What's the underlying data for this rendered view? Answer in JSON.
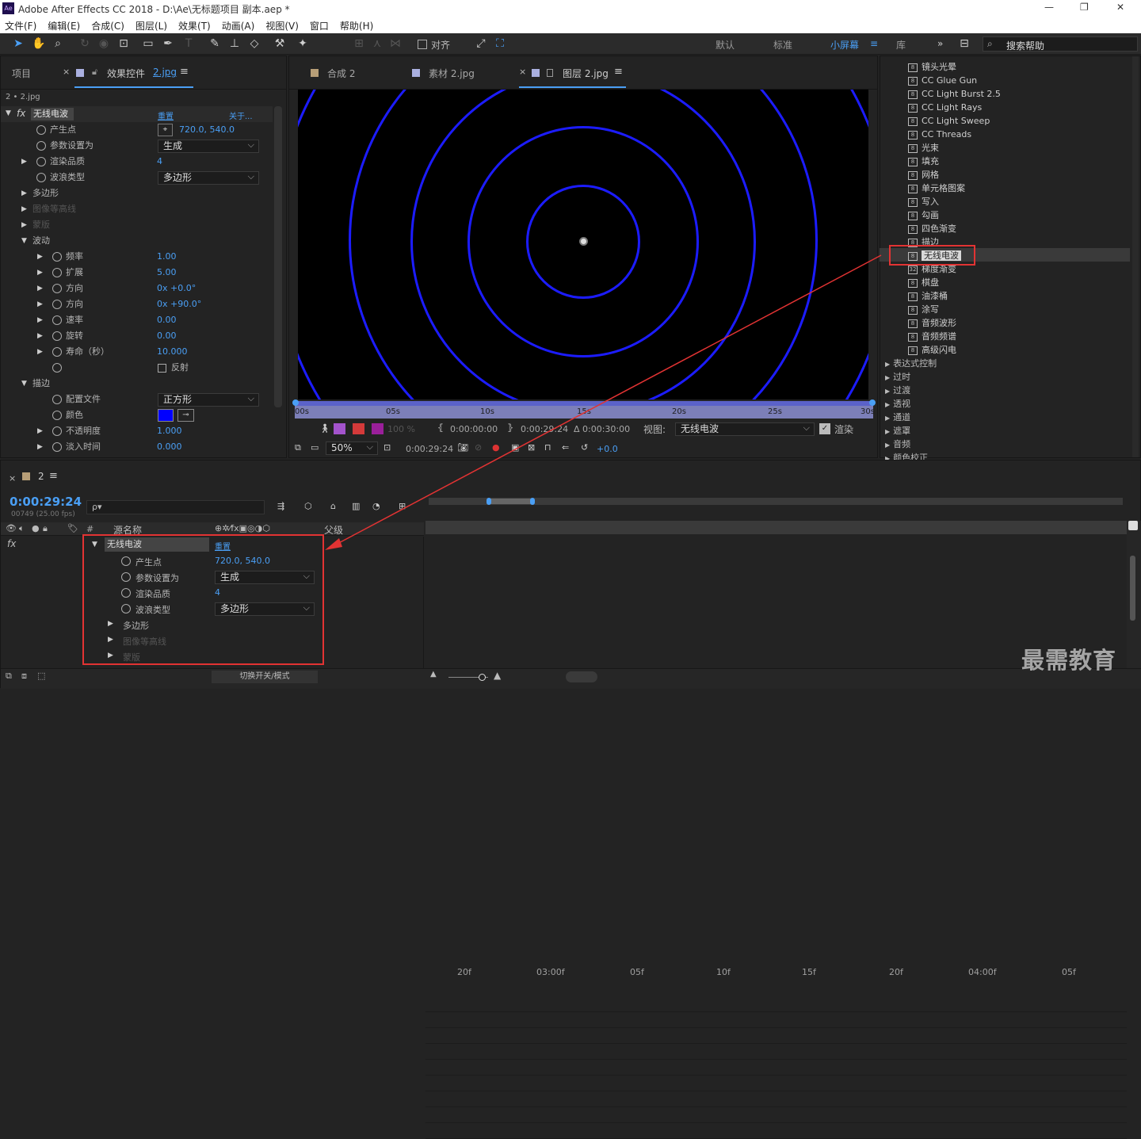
{
  "app": {
    "title": "Adobe After Effects CC 2018 - D:\\Ae\\无标题项目 副本.aep *",
    "icon": "Ae"
  },
  "window": {
    "minimize": "—",
    "restore": "❐",
    "close": "✕"
  },
  "menu": [
    "文件(F)",
    "编辑(E)",
    "合成(C)",
    "图层(L)",
    "效果(T)",
    "动画(A)",
    "视图(V)",
    "窗口",
    "帮助(H)"
  ],
  "toolbar": {
    "snap_label": "对齐",
    "workspaces": [
      "默认",
      "标准",
      "小屏幕",
      "库"
    ],
    "active_workspace": "小屏幕",
    "more": "»",
    "search_placeholder": "搜索帮助"
  },
  "effect_panel": {
    "project_tab": "项目",
    "tab_label": "效果控件",
    "tab_file": "2.jpg",
    "breadcrumb": "2 • 2.jpg",
    "effect_name": "无线电波",
    "reset": "重置",
    "about": "关于...",
    "rows": [
      {
        "label": "产生点",
        "value": "720.0, 540.0"
      },
      {
        "label": "参数设置为",
        "value": "生成"
      },
      {
        "label": "渲染品质",
        "value": "4"
      },
      {
        "label": "波浪类型",
        "value": "多边形"
      },
      {
        "label": "多边形"
      },
      {
        "label": "图像等高线"
      },
      {
        "label": "蒙版"
      },
      {
        "label": "波动"
      },
      {
        "label": "频率",
        "value": "1.00"
      },
      {
        "label": "扩展",
        "value": "5.00"
      },
      {
        "label": "方向",
        "value": "0x +0.0°"
      },
      {
        "label": "方向",
        "value": "0x +90.0°"
      },
      {
        "label": "速率",
        "value": "0.00"
      },
      {
        "label": "旋转",
        "value": "0.00"
      },
      {
        "label": "寿命（秒）",
        "value": "10.000"
      },
      {
        "label": "反射"
      },
      {
        "label": "描边"
      },
      {
        "label": "配置文件",
        "value": "正方形"
      },
      {
        "label": "颜色",
        "color": "#0000ff"
      },
      {
        "label": "不透明度",
        "value": "1.000"
      },
      {
        "label": "淡入时间",
        "value": "0.000"
      }
    ]
  },
  "viewer": {
    "tabs": [
      "合成 2",
      "素材 2.jpg",
      "图层 2.jpg"
    ],
    "ruler": [
      "00s",
      "05s",
      "10s",
      "15s",
      "20s",
      "25s",
      "30s"
    ],
    "bar": {
      "zoom_pct": "100 %",
      "in_time": "0:00:00:00",
      "out_time": "0:00:29:24",
      "duration": "Δ 0:00:30:00",
      "view_label": "视图:",
      "view_value": "无线电波",
      "render": "渲染"
    },
    "bottom": {
      "zoom": "50%",
      "time": "0:00:29:24",
      "exposure": "+0.0"
    }
  },
  "effects_list": {
    "items": [
      "镜头光晕",
      "CC Glue Gun",
      "CC Light Burst 2.5",
      "CC Light Rays",
      "CC Light Sweep",
      "CC Threads",
      "光束",
      "填充",
      "网格",
      "单元格图案",
      "写入",
      "勾画",
      "四色渐变",
      "描边",
      "无线电波",
      "梯度渐变",
      "棋盘",
      "油漆桶",
      "涂写",
      "音频波形",
      "音频频谱",
      "高级闪电"
    ],
    "categories": [
      "表达式控制",
      "过时",
      "过渡",
      "透视",
      "通道",
      "遮罩",
      "音频",
      "颜色校正"
    ]
  },
  "timeline": {
    "comp_tab": "2",
    "timecode": "0:00:29:24",
    "frames": "00749 (25.00 fps)",
    "search_placeholder": "ρ▾",
    "col_source": "源名称",
    "col_parent": "父级",
    "col_num": "#",
    "effect_name": "无线电波",
    "reset": "重置",
    "props": [
      {
        "label": "产生点",
        "value": "720.0, 540.0"
      },
      {
        "label": "参数设置为",
        "value": "生成"
      },
      {
        "label": "渲染品质",
        "value": "4"
      },
      {
        "label": "波浪类型",
        "value": "多边形"
      },
      {
        "label": "多边形"
      },
      {
        "label": "图像等高线"
      },
      {
        "label": "蒙版"
      }
    ],
    "ruler": [
      "20f",
      "03:00f",
      "05f",
      "10f",
      "15f",
      "20f",
      "04:00f",
      "05f"
    ],
    "toggle_label": "切换开关/模式"
  },
  "watermark": "最需教育",
  "colors": {
    "accent": "#4a9ff5",
    "highlight": "#e23333",
    "wave": "#1c1cff"
  }
}
